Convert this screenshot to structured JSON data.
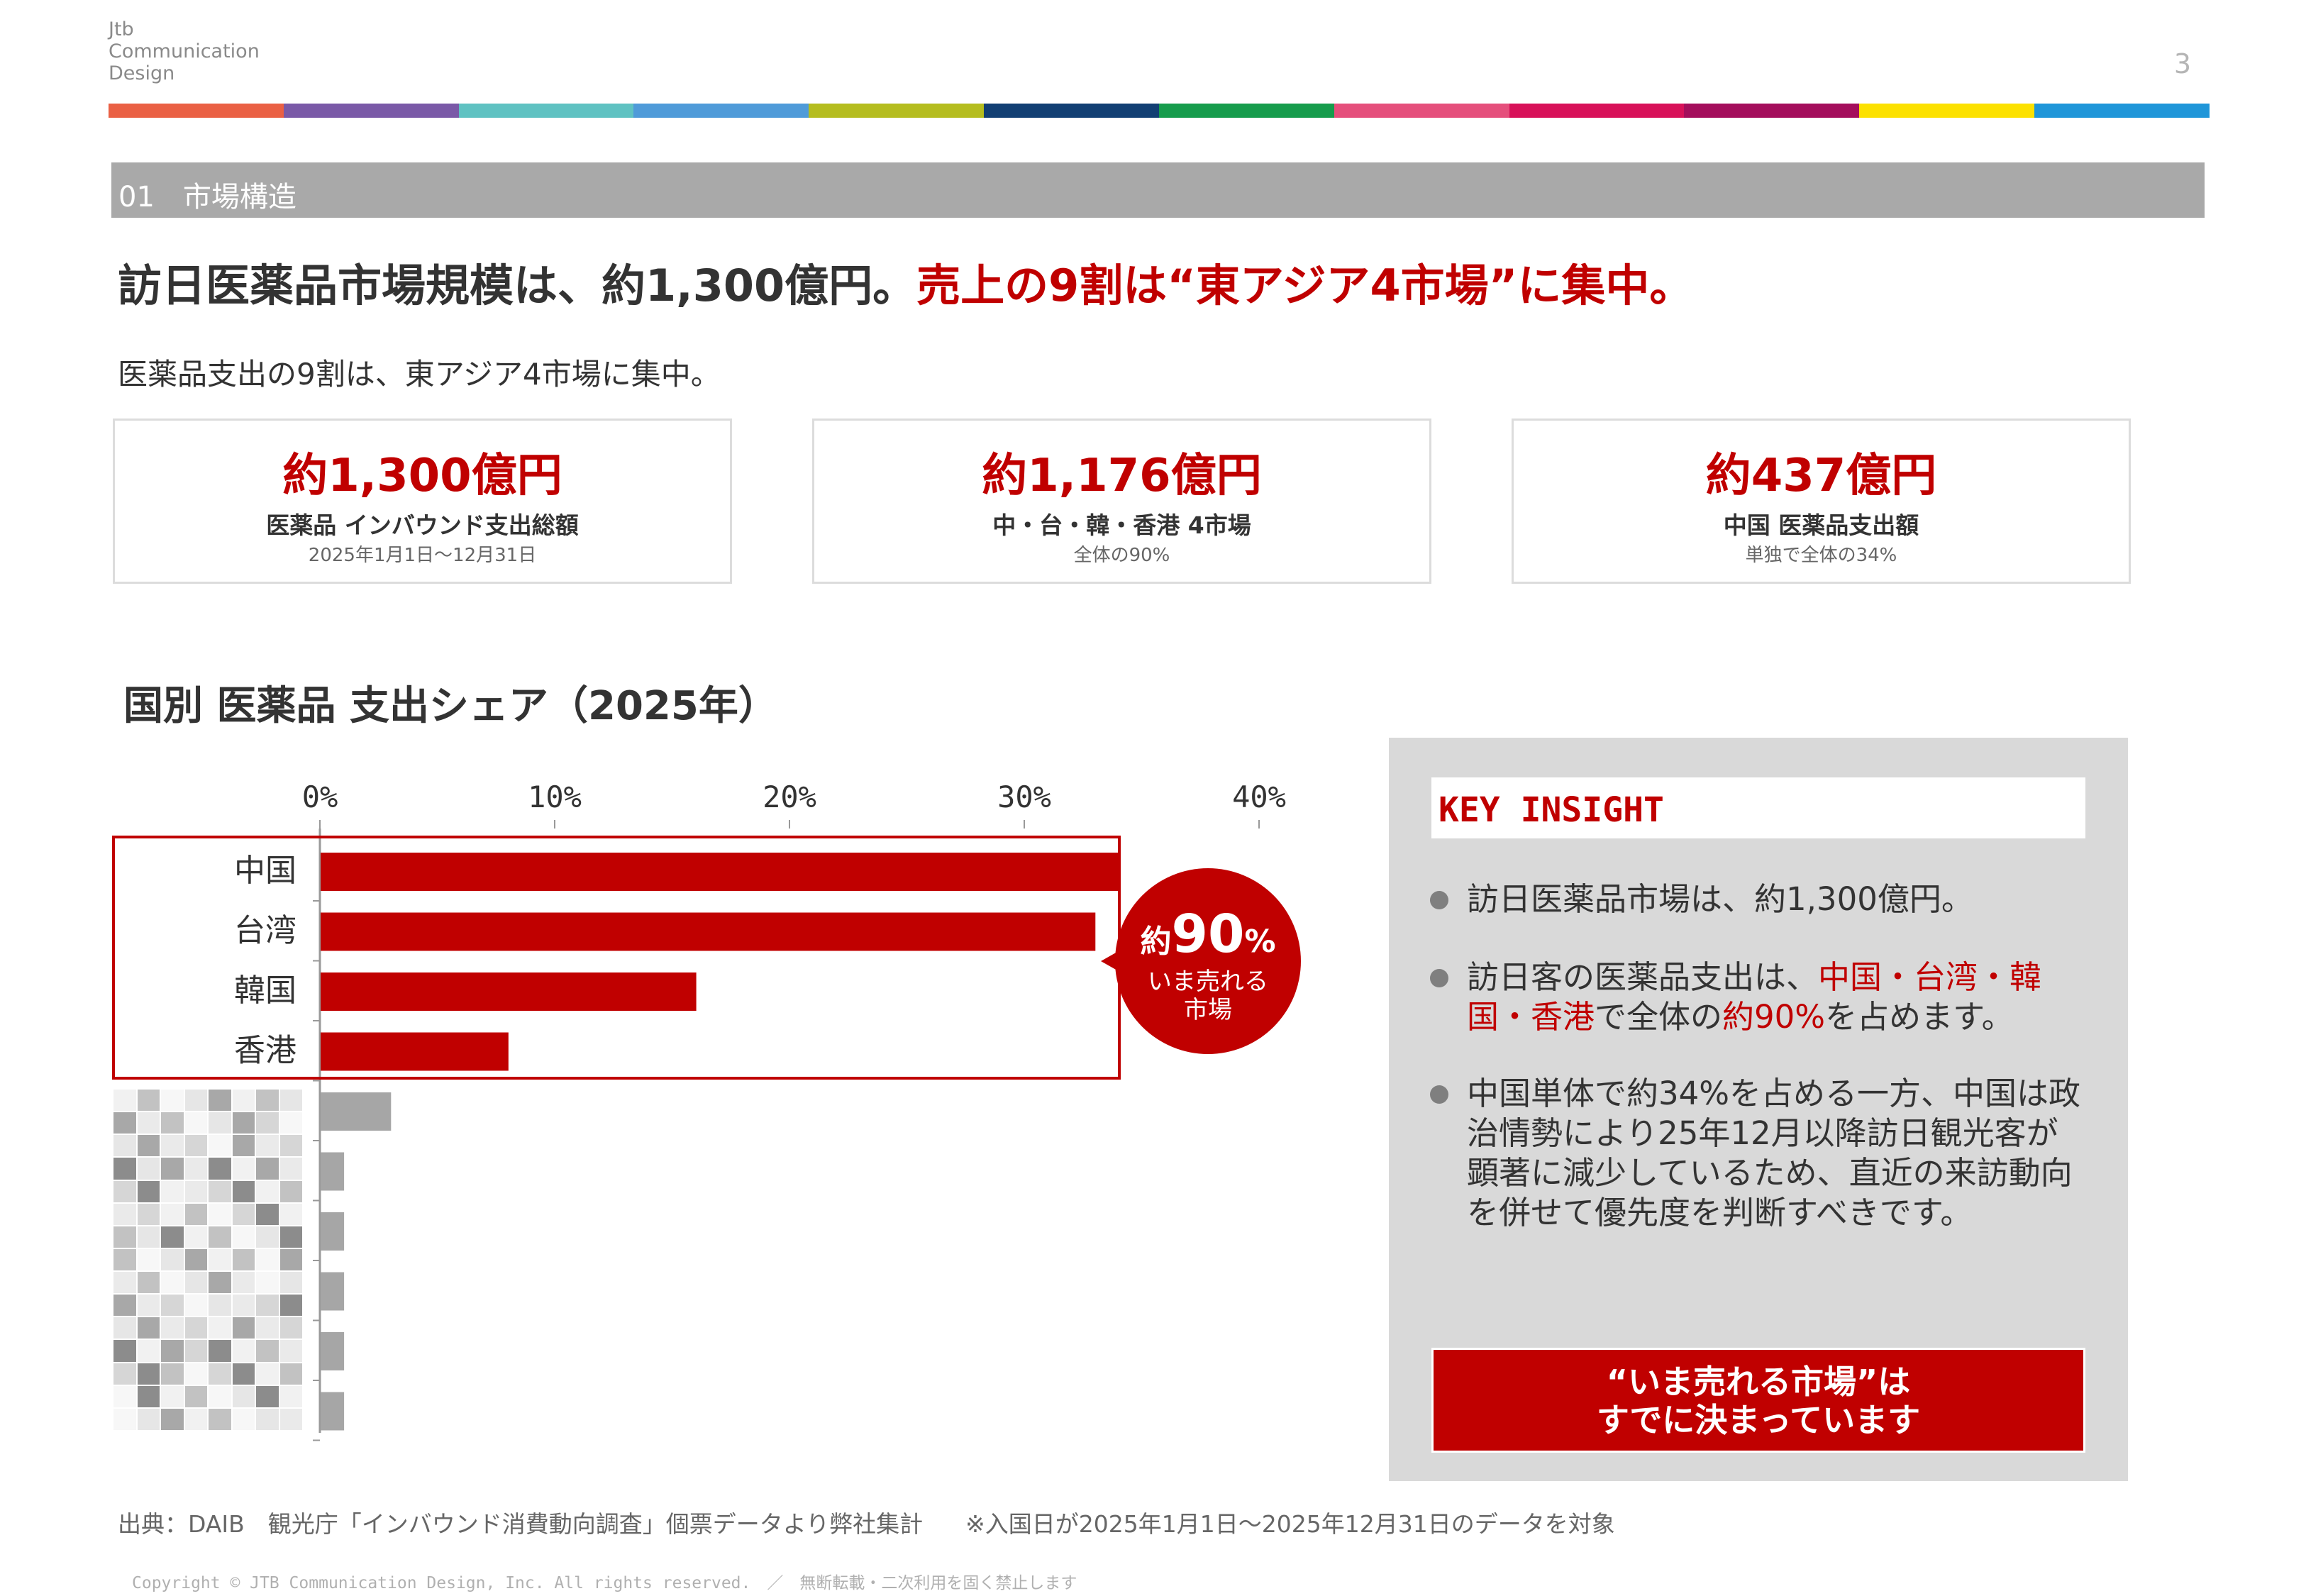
{
  "logo": {
    "line1": "Jtb",
    "line2": "Communication",
    "line3": "Design"
  },
  "page_number": "3",
  "color_bar": [
    "#ea6044",
    "#7a59a7",
    "#5fc2c2",
    "#4f9bd9",
    "#b5bd1f",
    "#123f73",
    "#169c4c",
    "#e54f7c",
    "#d81159",
    "#a40e5c",
    "#fce100",
    "#1f96d9"
  ],
  "section": {
    "label": "01　市場構造"
  },
  "headline": {
    "part1": "訪日医薬品市場規模は、約1,300億円。",
    "part2": "売上の9割は“東アジア4市場”に集中。"
  },
  "subline": "医薬品支出の9割は、東アジア4市場に集中。",
  "kpis": [
    {
      "value": "約1,300億円",
      "label": "医薬品 インバウンド支出総額",
      "note": "2025年1月1日～12月31日"
    },
    {
      "value": "約1,176億円",
      "label": "中・台・韓・香港 4市場",
      "note": "全体の90%"
    },
    {
      "value": "約437億円",
      "label": "中国 医薬品支出額",
      "note": "単独で全体の34%"
    }
  ],
  "chart_title": "国別 医薬品 支出シェア（2025年）",
  "chart_data": {
    "type": "bar",
    "orientation": "horizontal",
    "categories": [
      "中国",
      "台湾",
      "韓国",
      "香港",
      "",
      "",
      "",
      "",
      "",
      ""
    ],
    "values": [
      34,
      33,
      16,
      8,
      3,
      1,
      1,
      1,
      1,
      1
    ],
    "xlim": [
      0,
      40
    ],
    "x_ticks": [
      "0%",
      "10%",
      "20%",
      "30%",
      "40%"
    ],
    "highlight_colors": {
      "top4": "#c00000",
      "others": "#a6a6a6"
    },
    "callout": {
      "prefix": "約",
      "value": "90",
      "unit": "%",
      "line1": "いま売れる",
      "line2": "市場"
    }
  },
  "insight": {
    "title": "KEY INSIGHT",
    "b1": "訪日医薬品市場は、約1,300億円。",
    "b2_a": "訪日客の医薬品支出は、",
    "b2_red1": "中国・台湾・韓国・香港",
    "b2_b": "で全体の",
    "b2_red2": "約90%",
    "b2_c": "を占めます。",
    "b3": "中国単体で約34%を占める一方、中国は政治情勢により25年12月以降訪日観光客が顕著に減少しているため、直近の来訪動向を併せて優先度を判断すべきです。",
    "cta_line1": "“いま売れる市場”は",
    "cta_line2": "すでに決まっています"
  },
  "source": {
    "main": "出典：DAIB　観光庁「インバウンド消費動向調査」個票データより弊社集計",
    "note": "※入国日が2025年1月1日～2025年12月31日のデータを対象"
  },
  "copyright": "Copyright © JTB Communication Design, Inc. All rights reserved.　／　無断転載・二次利用を固く禁止します"
}
